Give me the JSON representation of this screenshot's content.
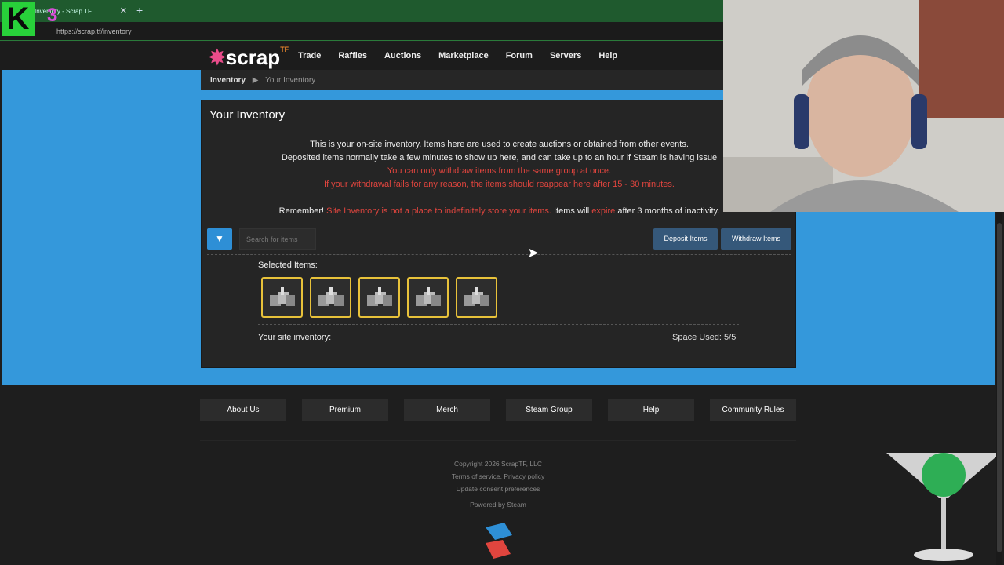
{
  "browser": {
    "tab_title": "Inventory - Scrap.TF",
    "url": "https://scrap.tf/inventory",
    "new_tab_icon": "plus-icon",
    "close_icon": "close-icon"
  },
  "overlay": {
    "channel_logo": "K",
    "badge": "3"
  },
  "site": {
    "logo_text": "scrap",
    "logo_suffix": "TF",
    "nav": [
      {
        "label": "Trade"
      },
      {
        "label": "Raffles"
      },
      {
        "label": "Auctions"
      },
      {
        "label": "Marketplace"
      },
      {
        "label": "Forum"
      },
      {
        "label": "Servers"
      },
      {
        "label": "Help"
      }
    ]
  },
  "breadcrumb": {
    "root": "Inventory",
    "current": "Your Inventory"
  },
  "panel": {
    "title": "Your Inventory",
    "info_line1": "This is your on-site inventory. Items here are used to create auctions or obtained from other events.",
    "info_line2": "Deposited items normally take a few minutes to show up here, and can take up to an hour if Steam is having issue",
    "info_line3": "You can only withdraw items from the same group at once.",
    "info_line4": "If your withdrawal fails for any reason, the items should reappear here after 15 - 30 minutes.",
    "remember_a": "Remember!",
    "remember_b": "Site Inventory is not a place to indefinitely store your items.",
    "remember_c": "Items will",
    "remember_d": "expire",
    "remember_e": "after 3 months of inactivity.",
    "search_placeholder": "Search for items",
    "deposit_label": "Deposit Items",
    "withdraw_label": "Withdraw Items",
    "selected_label": "Selected Items:",
    "selected_count": 5,
    "site_inventory_label": "Your site inventory:",
    "space_used": "Space Used: 5/5"
  },
  "footer": {
    "buttons": [
      "About Us",
      "Premium",
      "Merch",
      "Steam Group",
      "Help",
      "Community Rules"
    ],
    "copyright": "Copyright 2026 ScrapTF, LLC",
    "terms": "Terms of service, Privacy policy",
    "consent": "Update consent preferences",
    "powered": "Powered by Steam"
  },
  "colors": {
    "accent_blue": "#3498db",
    "warning_red": "#e0453e",
    "item_border": "#e8c23a"
  }
}
